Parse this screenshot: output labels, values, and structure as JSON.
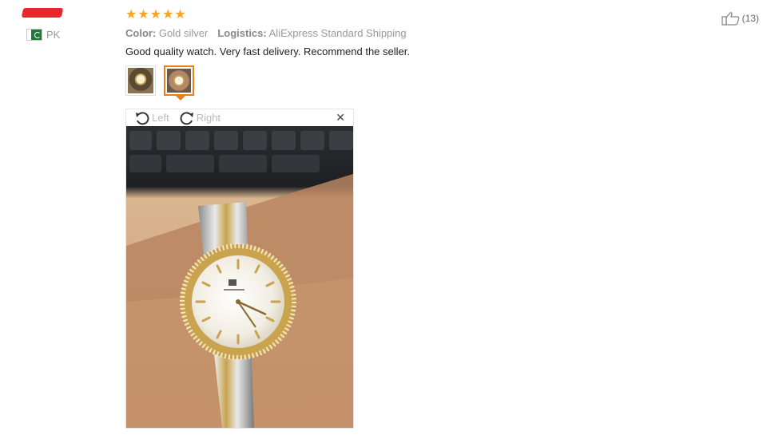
{
  "user": {
    "country_code": "PK"
  },
  "review": {
    "rating": 5,
    "stars": [
      "★",
      "★",
      "★",
      "★",
      "★"
    ],
    "color_label": "Color:",
    "color_value": "Gold silver",
    "logistics_label": "Logistics:",
    "logistics_value": "AliExpress Standard Shipping",
    "text": "Good quality watch. Very fast delivery. Recommend the seller."
  },
  "viewer": {
    "rotate_left_label": "Left",
    "rotate_right_label": "Right",
    "close_glyph": "✕"
  },
  "helpful": {
    "count": "(13)"
  },
  "colors": {
    "star": "#f5a623",
    "active_thumb": "#e8801a"
  }
}
